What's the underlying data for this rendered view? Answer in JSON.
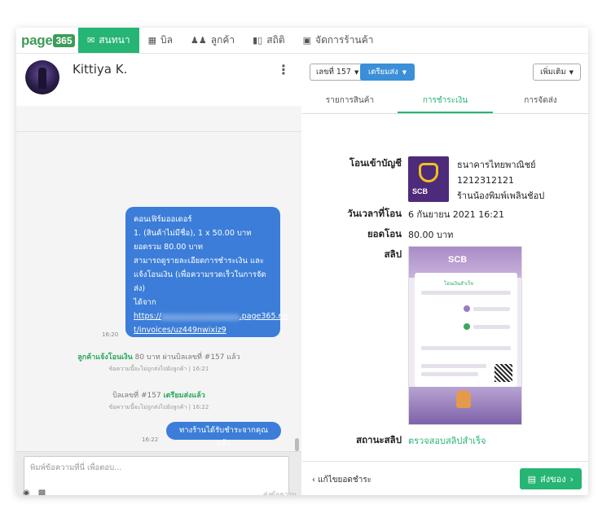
{
  "brand": {
    "logo_text": "page",
    "logo_num": "365"
  },
  "nav": [
    {
      "label": "สนทนา",
      "icon": "envelope-icon",
      "active": true
    },
    {
      "label": "บิล",
      "icon": "box-icon",
      "active": false
    },
    {
      "label": "ลูกค้า",
      "icon": "users-icon",
      "active": false
    },
    {
      "label": "สถิติ",
      "icon": "bar-chart-icon",
      "active": false
    },
    {
      "label": "จัดการร้านค้า",
      "icon": "store-icon",
      "active": false
    }
  ],
  "chat": {
    "customer_name": "Kittiya K.",
    "messages": {
      "order_lines": [
        "คอนเฟิร์มออเดอร์",
        "1. (สินค้าไม่มีชื่อ), 1 x 50.00 บาท",
        "ยอดรวม 80.00 บาท",
        "สามารถดูรายละเอียดการชำระเงิน และ",
        "แจ้งโอนเงิน (เพื่อความรวดเร็วในการจัด",
        "ส่ง)",
        "ได้จาก"
      ],
      "link_prefix": "https://",
      "link_blurred": "xxxxxxxxxxxxxxxxx",
      "link_suffix": ".page365.ne",
      "link_line2": "t/invoices/uz449nwixiz9",
      "time1": "16:20",
      "sys1_highlight": "ลูกค้าแจ้งโอนเงิน",
      "sys1_rest": " 80 บาท ผ่านบิลเลขที่ #157 แล้ว",
      "sys1_sub": "ข้อความนี้จะไม่ถูกส่งไปยังลูกค้า | 16:21",
      "sys2_prefix": "บิลเลขที่ #157 ",
      "sys2_highlight": "เตรียมส่งแล้ว",
      "sys2_sub": "ข้อความนี้จะไม่ถูกส่งไปยังลูกค้า | 16:22",
      "reply": "ทางร้านได้รับชำระจากคุณแล้ว",
      "time2": "16:22"
    },
    "composer": {
      "placeholder": "พิมพ์ข้อความที่นี่ เพื่อตอบ...",
      "send_label": "ส่งข้อความ"
    }
  },
  "order": {
    "bill_label": "เลขที่ 157",
    "status_label": "เตรียมส่ง",
    "more_label": "เพิ่มเติม",
    "tabs": [
      "รายการสินค้า",
      "การชำระเงิน",
      "การจัดส่ง"
    ],
    "active_tab": 1,
    "payment": {
      "transfer_label": "โอนเข้าบัญชี",
      "bank_name": "ธนาคารไทยพาณิชย์",
      "account_no": "1212312121",
      "account_name": "ร้านน้องพิมพ์เพลินช้อป",
      "bank_logo_text": "SCB",
      "datetime_label": "วันเวลาที่โอน",
      "datetime_value": "6 กันยายน 2021 16:21",
      "amount_label": "ยอดโอน",
      "amount_value": "80.00 บาท",
      "slip_label": "สลิป",
      "slip_status_label": "สถานะสลิป",
      "slip_status_value": "ตรวจสอบสลิปสำเร็จ",
      "slip_scb": "SCB",
      "slip_ok_text": "โอนเงินสำเร็จ"
    },
    "footer": {
      "fix_label": "แก้ไขยอดชำระ",
      "ship_label": "ส่งของ"
    }
  },
  "colors": {
    "brand_green": "#26b574",
    "bubble_blue": "#3b7dd8",
    "status_blue": "#3b8fd8"
  }
}
